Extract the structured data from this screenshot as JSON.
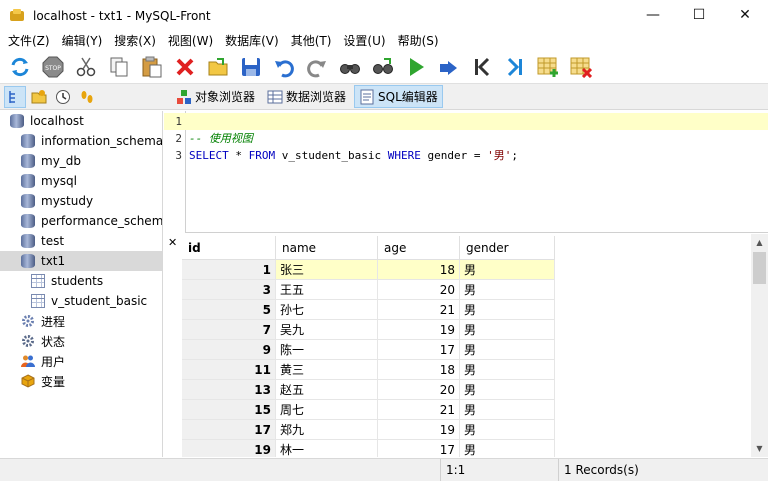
{
  "window": {
    "title": "localhost - txt1 - MySQL-Front"
  },
  "window_controls": {
    "minimize": "—",
    "maximize": "☐",
    "close": "✕"
  },
  "menu": [
    "文件(Z)",
    "编辑(Y)",
    "搜索(X)",
    "视图(W)",
    "数据库(V)",
    "其他(T)",
    "设置(U)",
    "帮助(S)"
  ],
  "toolbar": {
    "buttons": [
      "refresh-icon",
      "stop-icon",
      "cut-icon",
      "copy-icon",
      "paste-icon",
      "delete-icon",
      "open-icon",
      "save-icon",
      "undo-icon",
      "redo-icon",
      "find-icon",
      "replace-icon",
      "run-icon",
      "run-line-icon",
      "first-icon",
      "last-icon",
      "insert-record-icon",
      "delete-record-icon"
    ]
  },
  "view_tabs": [
    {
      "label": "对象浏览器",
      "active": false
    },
    {
      "label": "数据浏览器",
      "active": false
    },
    {
      "label": "SQL编辑器",
      "active": true
    }
  ],
  "tree": {
    "root": "localhost",
    "databases": [
      "information_schema",
      "my_db",
      "mysql",
      "mystudy",
      "performance_schema",
      "test",
      "txt1"
    ],
    "selected_db": "txt1",
    "txt1_children": [
      "students",
      "v_student_basic"
    ],
    "extras": [
      "进程",
      "状态",
      "用户",
      "变量"
    ]
  },
  "editor": {
    "lines": [
      {
        "num": "1",
        "text": ""
      },
      {
        "num": "2",
        "text": "-- 使用视图"
      },
      {
        "num": "3",
        "text": "SELECT * FROM v_student_basic WHERE gender = '男';"
      }
    ]
  },
  "grid": {
    "close_label": "✕",
    "columns": [
      "id",
      "name",
      "age",
      "gender"
    ],
    "rows": [
      {
        "id": "1",
        "name": "张三",
        "age": "18",
        "gender": "男"
      },
      {
        "id": "3",
        "name": "王五",
        "age": "20",
        "gender": "男"
      },
      {
        "id": "5",
        "name": "孙七",
        "age": "21",
        "gender": "男"
      },
      {
        "id": "7",
        "name": "吴九",
        "age": "19",
        "gender": "男"
      },
      {
        "id": "9",
        "name": "陈一",
        "age": "17",
        "gender": "男"
      },
      {
        "id": "11",
        "name": "黄三",
        "age": "18",
        "gender": "男"
      },
      {
        "id": "13",
        "name": "赵五",
        "age": "20",
        "gender": "男"
      },
      {
        "id": "15",
        "name": "周七",
        "age": "21",
        "gender": "男"
      },
      {
        "id": "17",
        "name": "郑九",
        "age": "19",
        "gender": "男"
      },
      {
        "id": "19",
        "name": "林一",
        "age": "17",
        "gender": "男"
      }
    ],
    "selected_row": 0
  },
  "status": {
    "cursor": "1:1",
    "records": "1 Records(s)"
  },
  "colors": {
    "current_line": "#ffffc8",
    "keyword": "#0000c0",
    "comment": "#008000",
    "string": "#800000",
    "selection": "#cce4f7"
  }
}
